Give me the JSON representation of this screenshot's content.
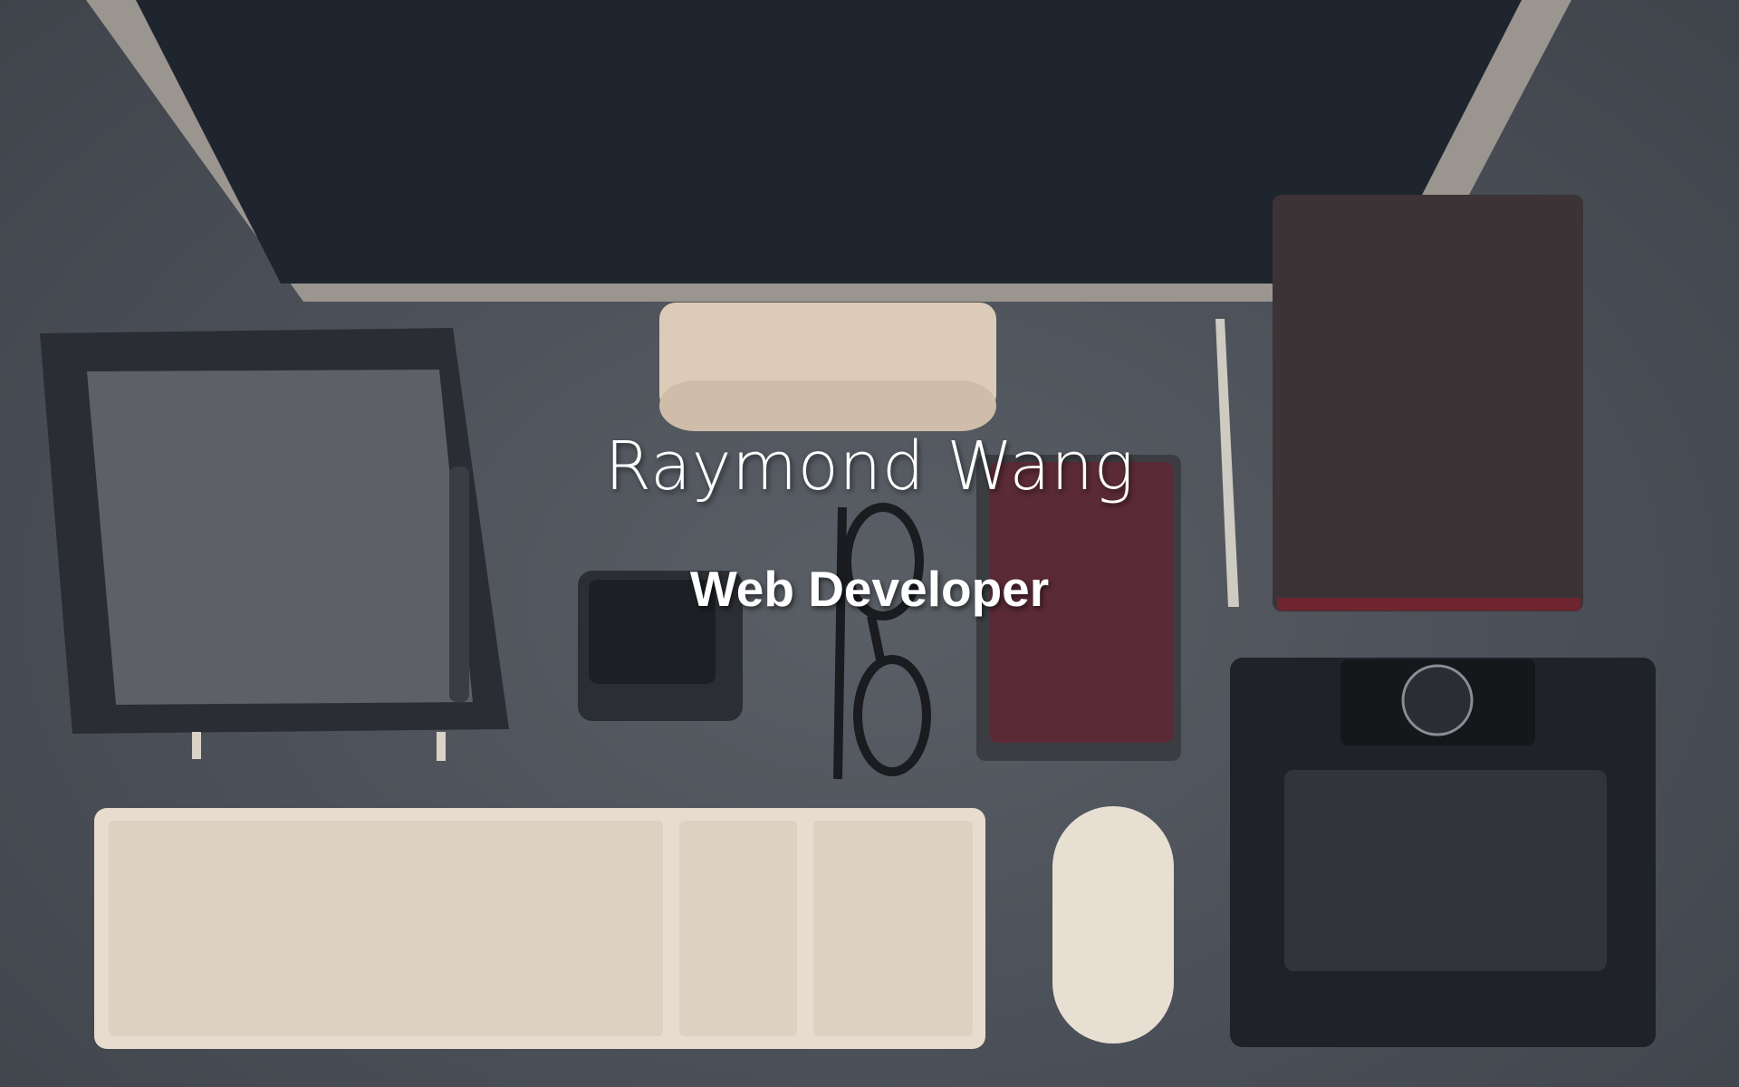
{
  "hero": {
    "name": "Raymond Wang",
    "title": "Web Developer"
  },
  "colors": {
    "desk": "#4b5058",
    "monitor_screen": "#1f252e",
    "keyboard": "#e7dccd",
    "notebook_cover": "#5a2a36",
    "text": "#ffffff"
  },
  "icons": [
    "monitor",
    "tablet",
    "phone-dock",
    "glasses",
    "notebook",
    "pen",
    "leather-folio",
    "drawing-tablet",
    "keyboard",
    "mouse"
  ]
}
